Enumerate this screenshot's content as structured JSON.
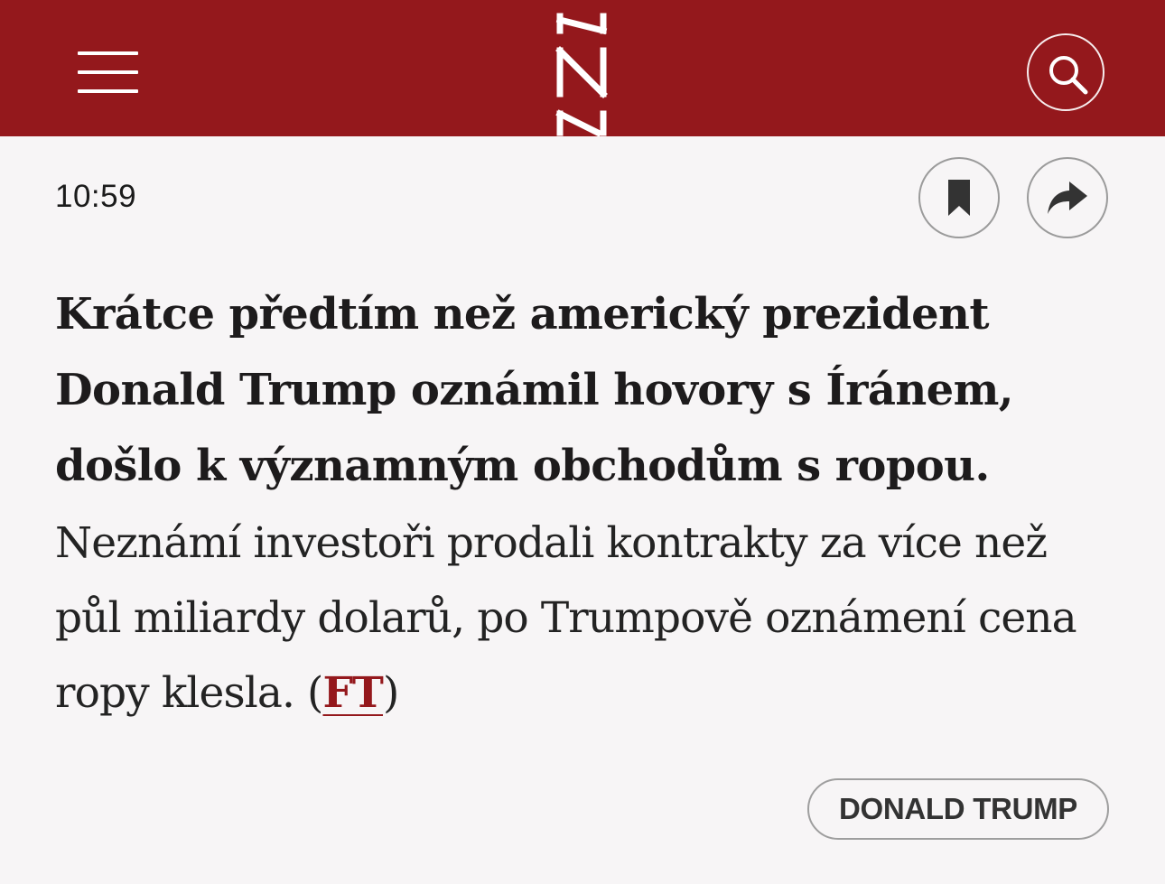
{
  "colors": {
    "brand": "#94181c",
    "background": "#f7f5f6",
    "text": "#1b1b1b"
  },
  "header": {
    "menu_icon": "hamburger-menu-icon",
    "logo": "denik-n-logo",
    "search_icon": "search-icon"
  },
  "article": {
    "time": "10:59",
    "bookmark_icon": "bookmark-icon",
    "share_icon": "share-arrow-icon",
    "headline": "Krátce předtím než americký prezident Donald Trump oznámil hovory s Íránem, došlo k významným obchodům s ropou.",
    "body_main": "Neznámí investoři prodali kontrakty za více než půl miliardy dolarů, po Trumpově oznámení cena ropy klesla. (",
    "source_label": "FT",
    "body_end": ")",
    "tag": "DONALD TRUMP"
  }
}
